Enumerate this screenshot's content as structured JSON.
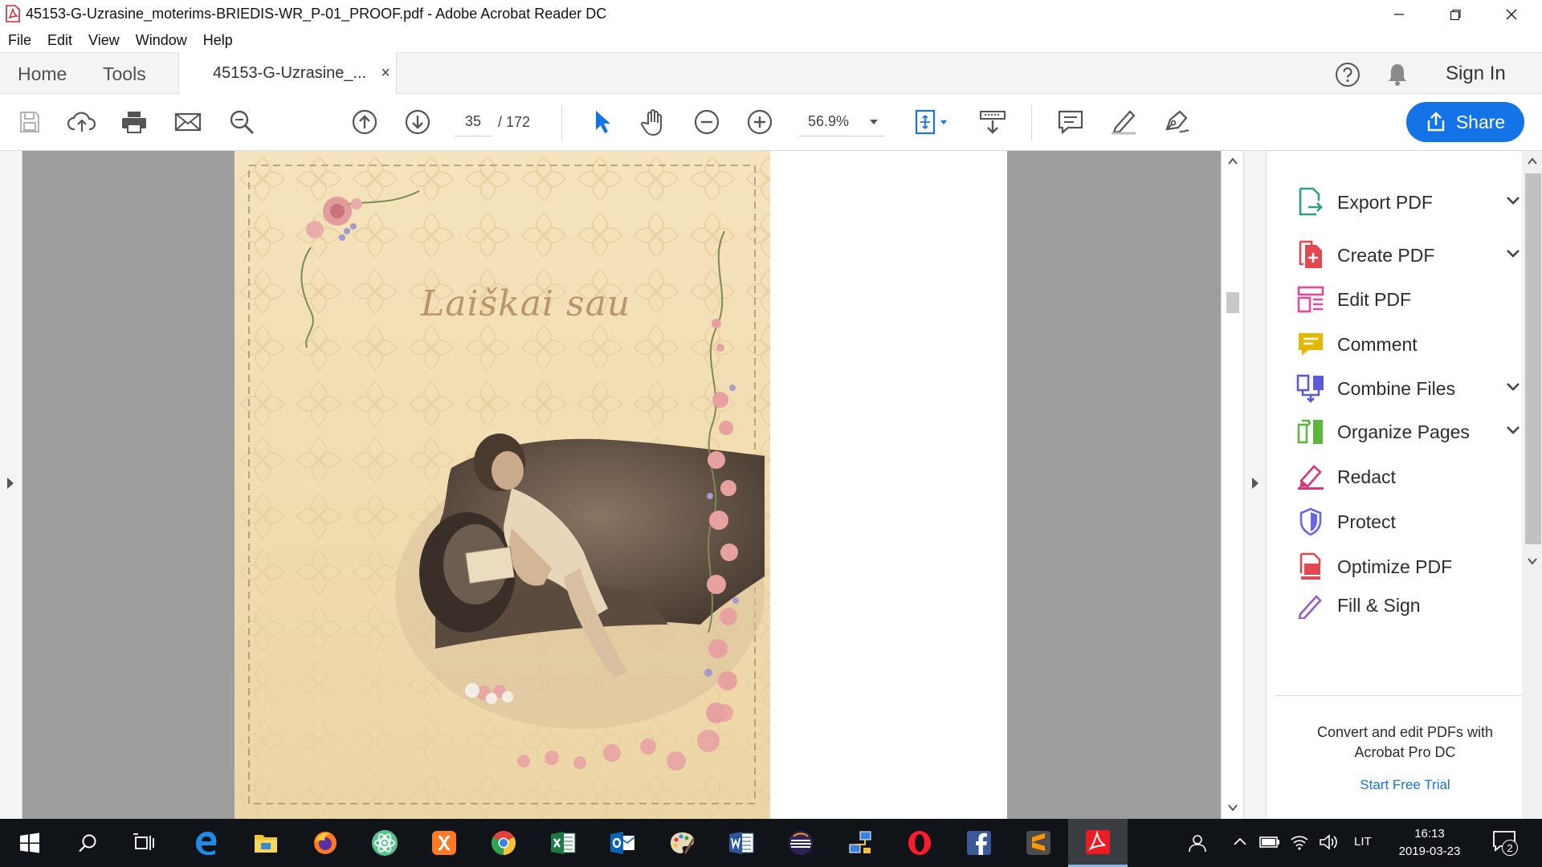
{
  "window": {
    "title": "45153-G-Uzrasine_moterims-BRIEDIS-WR_P-01_PROOF.pdf - Adobe Acrobat Reader DC",
    "minimize_glyph": "—",
    "maximize_glyph": "❐",
    "close_glyph": "✕"
  },
  "menu": [
    "File",
    "Edit",
    "View",
    "Window",
    "Help"
  ],
  "tabs": {
    "home": "Home",
    "tools": "Tools",
    "document": "45153-G-Uzrasine_...",
    "close_glyph": "×",
    "sign_in": "Sign In"
  },
  "toolbar": {
    "page_current": "35",
    "page_total": "/ 172",
    "zoom": "56.9%",
    "share": "Share",
    "icons": [
      "save-icon",
      "upload-icon",
      "print-icon",
      "email-icon",
      "search-icon",
      "page-up-icon",
      "page-down-icon",
      "select-cursor-icon",
      "hand-icon",
      "zoom-out-icon",
      "zoom-in-icon",
      "fit-page-icon",
      "scroll-mode-icon",
      "comment-icon",
      "highlight-icon",
      "sign-icon"
    ]
  },
  "document": {
    "cover_title": "Laiškai sau"
  },
  "tools_pane": {
    "items": [
      {
        "label": "Export PDF",
        "color": "#2e9e8a",
        "has_chevron": true
      },
      {
        "label": "Create PDF",
        "color": "#e34850",
        "has_chevron": true
      },
      {
        "label": "Edit PDF",
        "color": "#e4489a",
        "has_chevron": false
      },
      {
        "label": "Comment",
        "color": "#e5b800",
        "has_chevron": false
      },
      {
        "label": "Combine Files",
        "color": "#5a5ad8",
        "has_chevron": true
      },
      {
        "label": "Organize Pages",
        "color": "#5cb83c",
        "has_chevron": true
      },
      {
        "label": "Redact",
        "color": "#d8387a",
        "has_chevron": false
      },
      {
        "label": "Protect",
        "color": "#6767e6",
        "has_chevron": false
      },
      {
        "label": "Optimize PDF",
        "color": "#e34850",
        "has_chevron": false
      },
      {
        "label": "Fill & Sign",
        "color": "#9b59d0",
        "has_chevron": false
      }
    ],
    "promo": "Convert and edit PDFs with Acrobat Pro DC",
    "trial_link": "Start Free Trial"
  },
  "taskbar": {
    "apps": [
      "start-icon",
      "search-icon",
      "task-view-icon",
      "edge-icon",
      "file-explorer-icon",
      "firefox-icon",
      "atom-icon",
      "xampp-icon",
      "chrome-icon",
      "excel-icon",
      "outlook-icon",
      "paint-icon",
      "word-icon",
      "eclipse-icon",
      "network-icon",
      "opera-icon",
      "facebook-icon",
      "sublime-icon",
      "acrobat-icon"
    ],
    "language": "LIT",
    "time": "16:13",
    "date": "2019-03-23",
    "notification_count": "2"
  },
  "colors": {
    "accent": "#1473e6",
    "taskbar": "#101418",
    "canvas": "#9d9d9d"
  }
}
